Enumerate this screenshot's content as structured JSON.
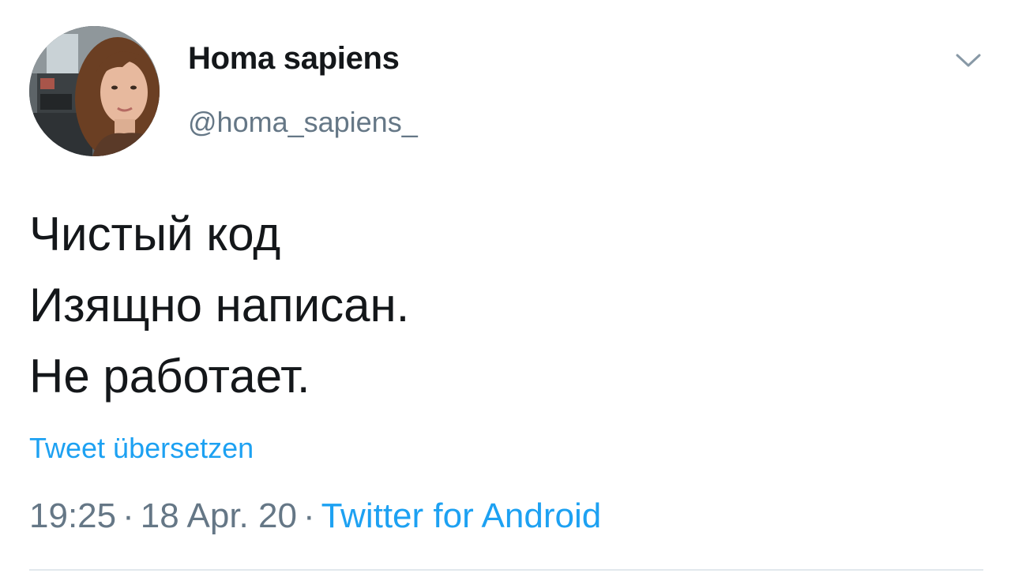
{
  "tweet": {
    "author": {
      "display_name": "Homa sapiens",
      "handle": "@homa_sapiens_",
      "avatar_icon": "user-avatar-photo"
    },
    "text_lines": [
      "Чистый код",
      "Изящно написан.",
      "Не работает."
    ],
    "translate_label": "Tweet übersetzen",
    "time": "19:25",
    "date": "18 Apr. 20",
    "separator": "·",
    "source": "Twitter for Android",
    "menu_icon": "chevron-down-icon"
  },
  "colors": {
    "text_primary": "#14171a",
    "text_secondary": "#657786",
    "link": "#1da1f2",
    "divider": "#e1e8ed"
  }
}
